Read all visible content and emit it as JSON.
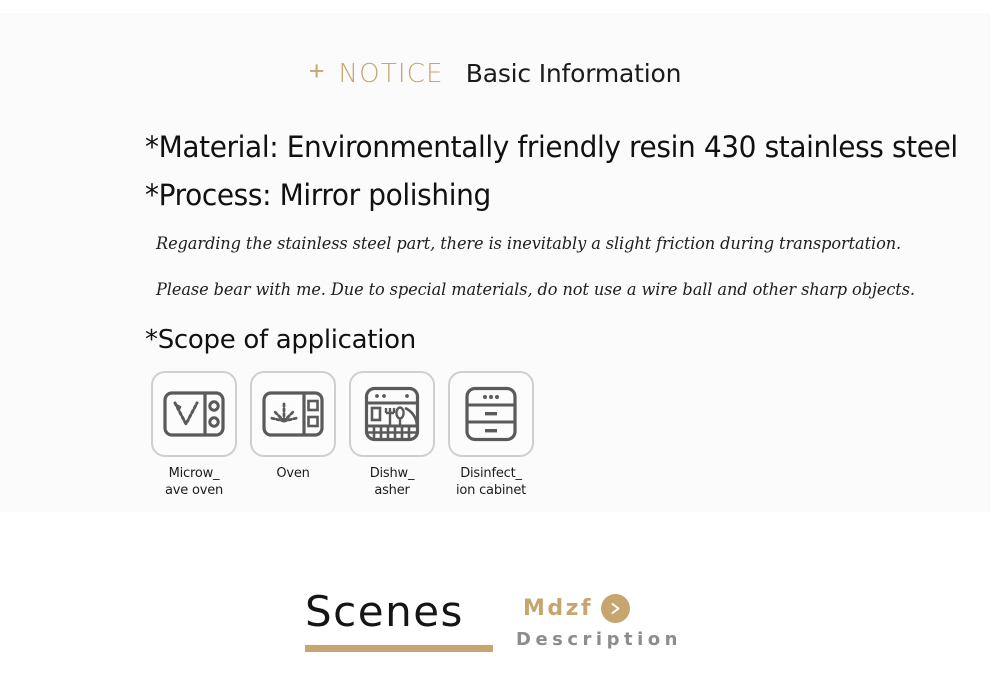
{
  "notice": {
    "plus": "+",
    "label": "NOTICE",
    "subtitle": "Basic Information",
    "accent_color": "#c7a56f"
  },
  "specs": [
    {
      "text": "*Material: Environmentally friendly resin 430 stainless steel"
    },
    {
      "text": "*Process: Mirror polishing"
    }
  ],
  "notes": [
    {
      "text": "Regarding the stainless steel part, there is inevitably a slight friction during transportation."
    },
    {
      "text": "Please bear with me. Due to special materials, do not use a wire ball and other sharp objects."
    }
  ],
  "scope": {
    "heading": "*Scope of application",
    "items": [
      {
        "icon": "microwave-oven-icon",
        "label": "Microw_\nave oven"
      },
      {
        "icon": "oven-icon",
        "label": "Oven"
      },
      {
        "icon": "dishwasher-icon",
        "label": "Dishw_\nasher"
      },
      {
        "icon": "disinfection-cabinet-icon",
        "label": "Disinfect_\nion cabinet"
      }
    ]
  },
  "scenes": {
    "title": "Scenes",
    "brand": "Mdzf",
    "description": "Description",
    "arrow_glyph": "›",
    "accent_color": "#c7a56f",
    "description_color": "#8d8d8d"
  }
}
